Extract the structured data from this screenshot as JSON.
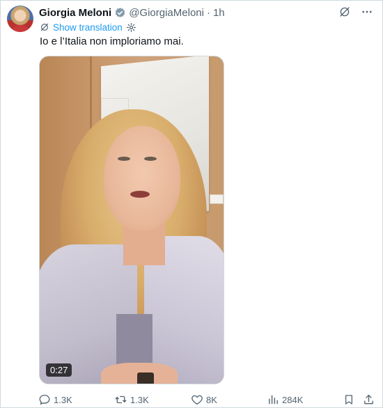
{
  "tweet": {
    "author_name": "Giorgia Meloni",
    "handle": "@GiorgiaMeloni",
    "separator": "·",
    "time": "1h",
    "show_translation": "Show translation",
    "text": "Io e l’Italia non imploriamo mai.",
    "media": {
      "type": "video",
      "duration": "0:27"
    }
  },
  "actions": {
    "replies": "1.3K",
    "reposts": "1.3K",
    "likes": "8K",
    "views": "284K"
  },
  "colors": {
    "accent": "#1d9bf0",
    "text_primary": "#0f1419",
    "text_secondary": "#536471",
    "border": "#cfd9de"
  },
  "icons": {
    "verified": "verified-badge-icon",
    "grok": "grok-icon",
    "more": "more-icon",
    "translate": "translate-icon",
    "settings": "gear-icon",
    "reply": "reply-icon",
    "repost": "repost-icon",
    "like": "heart-icon",
    "views": "views-icon",
    "bookmark": "bookmark-icon",
    "share": "share-icon"
  }
}
